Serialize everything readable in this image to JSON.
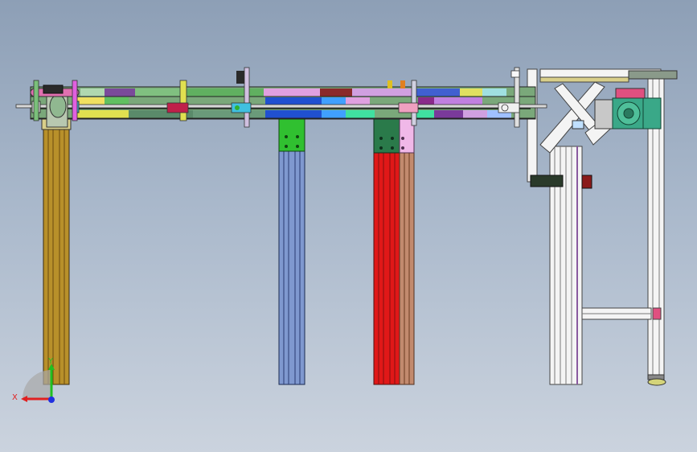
{
  "viewport": {
    "background_top": "#8d9fb6",
    "background_bottom": "#cbd3de"
  },
  "triad": {
    "x_label": "X",
    "y_label": "Y",
    "x_color": "#e02020",
    "y_color": "#20c020",
    "z_color": "#2030e0"
  },
  "parts": {
    "leg_1_color": "#b8902a",
    "leg_2_color": "#7f98cf",
    "leg_3_color": "#e01818",
    "leg_3_side_color": "#c28a6e",
    "bracket_green": "#30c030",
    "bracket_dark_green": "#2a7a4a",
    "frame_white": "#f4f4f4",
    "motor_green": "#3aa888"
  }
}
